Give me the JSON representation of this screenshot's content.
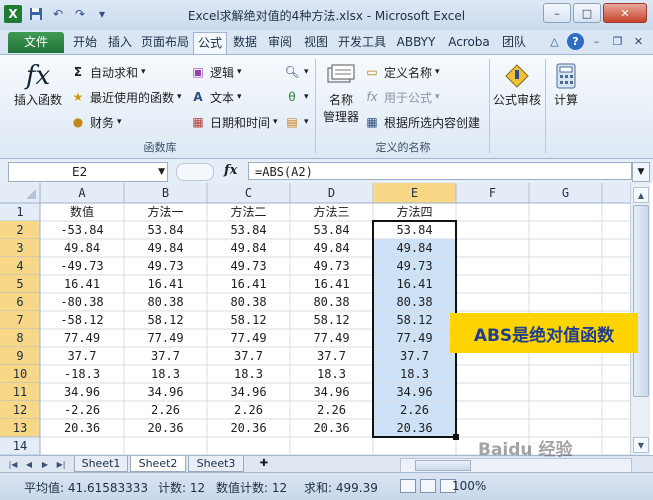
{
  "window": {
    "title": "Excel求解绝对值的4种方法.xlsx - Microsoft Excel",
    "min": "–",
    "max": "□",
    "close": "✕"
  },
  "qat": {
    "app_icon": "X"
  },
  "tabs": [
    "文件",
    "开始",
    "插入",
    "页面布局",
    "公式",
    "数据",
    "审阅",
    "视图",
    "开发工具",
    "ABBYY",
    "Acroba",
    "团队"
  ],
  "active_tab": "公式",
  "ribbon": {
    "function_library": {
      "insert_function": "插入函数",
      "autosum": "自动求和",
      "recent": "最近使用的函数",
      "financial": "财务",
      "logical": "逻辑",
      "text": "文本",
      "datetime": "日期和时间",
      "label": "函数库"
    },
    "defined_names": {
      "name_manager_line1": "名称",
      "name_manager_line2": "管理器",
      "define_name": "定义名称",
      "use_in_formula": "用于公式",
      "create_from_selection": "根据所选内容创建",
      "label": "定义的名称"
    },
    "formula_auditing": "公式审核",
    "calculation": "计算"
  },
  "formula_bar": {
    "name_box": "E2",
    "fx": "fx",
    "formula": "=ABS(A2)"
  },
  "grid": {
    "columns": [
      "A",
      "B",
      "C",
      "D",
      "E",
      "F",
      "G"
    ],
    "headers": [
      "数值",
      "方法一",
      "方法二",
      "方法三",
      "方法四"
    ],
    "rows": [
      [
        "-53.84",
        "53.84",
        "53.84",
        "53.84",
        "53.84"
      ],
      [
        "49.84",
        "49.84",
        "49.84",
        "49.84",
        "49.84"
      ],
      [
        "-49.73",
        "49.73",
        "49.73",
        "49.73",
        "49.73"
      ],
      [
        "16.41",
        "16.41",
        "16.41",
        "16.41",
        "16.41"
      ],
      [
        "-80.38",
        "80.38",
        "80.38",
        "80.38",
        "80.38"
      ],
      [
        "-58.12",
        "58.12",
        "58.12",
        "58.12",
        "58.12"
      ],
      [
        "77.49",
        "77.49",
        "77.49",
        "77.49",
        "77.49"
      ],
      [
        "37.7",
        "37.7",
        "37.7",
        "37.7",
        "37.7"
      ],
      [
        "-18.3",
        "18.3",
        "18.3",
        "18.3",
        "18.3"
      ],
      [
        "34.96",
        "34.96",
        "34.96",
        "34.96",
        "34.96"
      ],
      [
        "-2.26",
        "2.26",
        "2.26",
        "2.26",
        "2.26"
      ],
      [
        "20.36",
        "20.36",
        "20.36",
        "20.36",
        "20.36"
      ]
    ],
    "row_numbers": [
      "1",
      "2",
      "3",
      "4",
      "5",
      "6",
      "7",
      "8",
      "9",
      "10",
      "11",
      "12",
      "13",
      "14"
    ],
    "selected_column": "E",
    "selected_rows": [
      "2",
      "3",
      "4",
      "5",
      "6",
      "7",
      "8",
      "9",
      "10",
      "11",
      "12",
      "13"
    ],
    "colors": {
      "selection": "#cde1f7",
      "header_selected": "#f8d887",
      "gridline": "#d4dbe6"
    }
  },
  "callout": {
    "text": "ABS是绝对值函数",
    "bg": "#ffd400"
  },
  "sheets": [
    "Sheet1",
    "Sheet2",
    "Sheet3"
  ],
  "active_sheet": "Sheet2",
  "status": {
    "average": "平均值: 41.61583333",
    "count": "计数: 12",
    "numeric_count": "数值计数: 12",
    "sum": "求和: 499.39",
    "zoom": "100%"
  },
  "watermark": "Baidu 经验"
}
